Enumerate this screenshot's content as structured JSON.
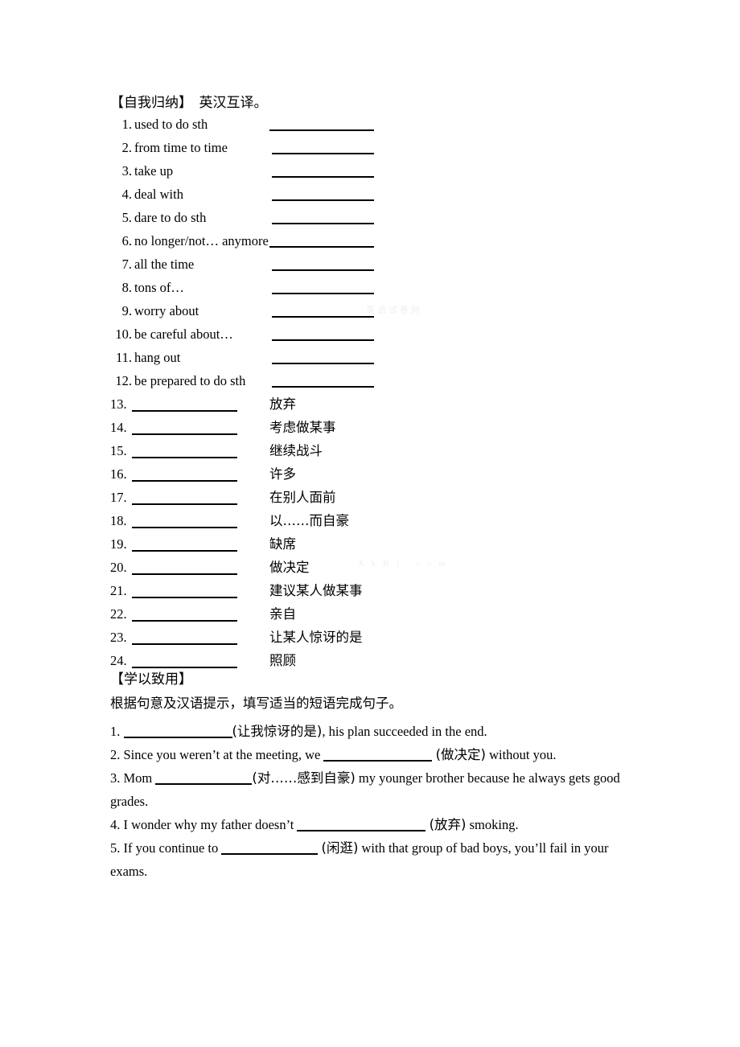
{
  "section1": {
    "heading": "【自我归纳】  英汉互译。",
    "items_en_to_cn": [
      {
        "num": "1.",
        "term": "used to do sth"
      },
      {
        "num": "2.",
        "term": "from time to time"
      },
      {
        "num": "3.",
        "term": "take up"
      },
      {
        "num": "4.",
        "term": "deal with"
      },
      {
        "num": "5.",
        "term": "dare to do sth"
      },
      {
        "num": "6.",
        "term": "no longer/not… anymore"
      },
      {
        "num": "7.",
        "term": "all the time"
      },
      {
        "num": "8.",
        "term": "tons of…"
      },
      {
        "num": "9.",
        "term": "worry about"
      },
      {
        "num": "10.",
        "term": "be careful about…"
      },
      {
        "num": "11.",
        "term": "hang out"
      },
      {
        "num": "12.",
        "term": "be prepared to do sth"
      }
    ],
    "items_cn_to_en": [
      {
        "num": "13.",
        "meaning": "放弃"
      },
      {
        "num": "14.",
        "meaning": "考虑做某事"
      },
      {
        "num": "15.",
        "meaning": "继续战斗"
      },
      {
        "num": "16.",
        "meaning": "许多"
      },
      {
        "num": "17.",
        "meaning": "在别人面前"
      },
      {
        "num": "18.",
        "meaning": "以……而自豪"
      },
      {
        "num": "19.",
        "meaning": "缺席"
      },
      {
        "num": "20.",
        "meaning": "做决定"
      },
      {
        "num": "21.",
        "meaning": "建议某人做某事"
      },
      {
        "num": "22.",
        "meaning": "亲自"
      },
      {
        "num": "23.",
        "meaning": "让某人惊讶的是"
      },
      {
        "num": "24.",
        "meaning": "照顾"
      }
    ]
  },
  "section2": {
    "heading": "【学以致用】",
    "instruction": "根据句意及汉语提示，填写适当的短语完成句子。",
    "sentences": [
      {
        "num": "1.",
        "before": "",
        "hint": "(让我惊讶的是)",
        "after": ", his plan succeeded in the end."
      },
      {
        "num": "2.",
        "before": "Since you weren’t at the meeting, we ",
        "hint": "(做决定)",
        "after": " without you."
      },
      {
        "num": "3.",
        "before": "Mom ",
        "hint": "(对……感到自豪)",
        "after": " my younger brother because he always gets good grades."
      },
      {
        "num": "4.",
        "before": "I wonder why my father doesn’t ",
        "hint": "(放弃)",
        "after": " smoking."
      },
      {
        "num": "5.",
        "before": "If you continue to ",
        "hint": "(闲逛)",
        "after": " with that group of bad boys, you’ll fail in your exams."
      }
    ]
  },
  "watermarks": {
    "one": "英语试卷网",
    "two": "X k B 1 . c o m"
  }
}
